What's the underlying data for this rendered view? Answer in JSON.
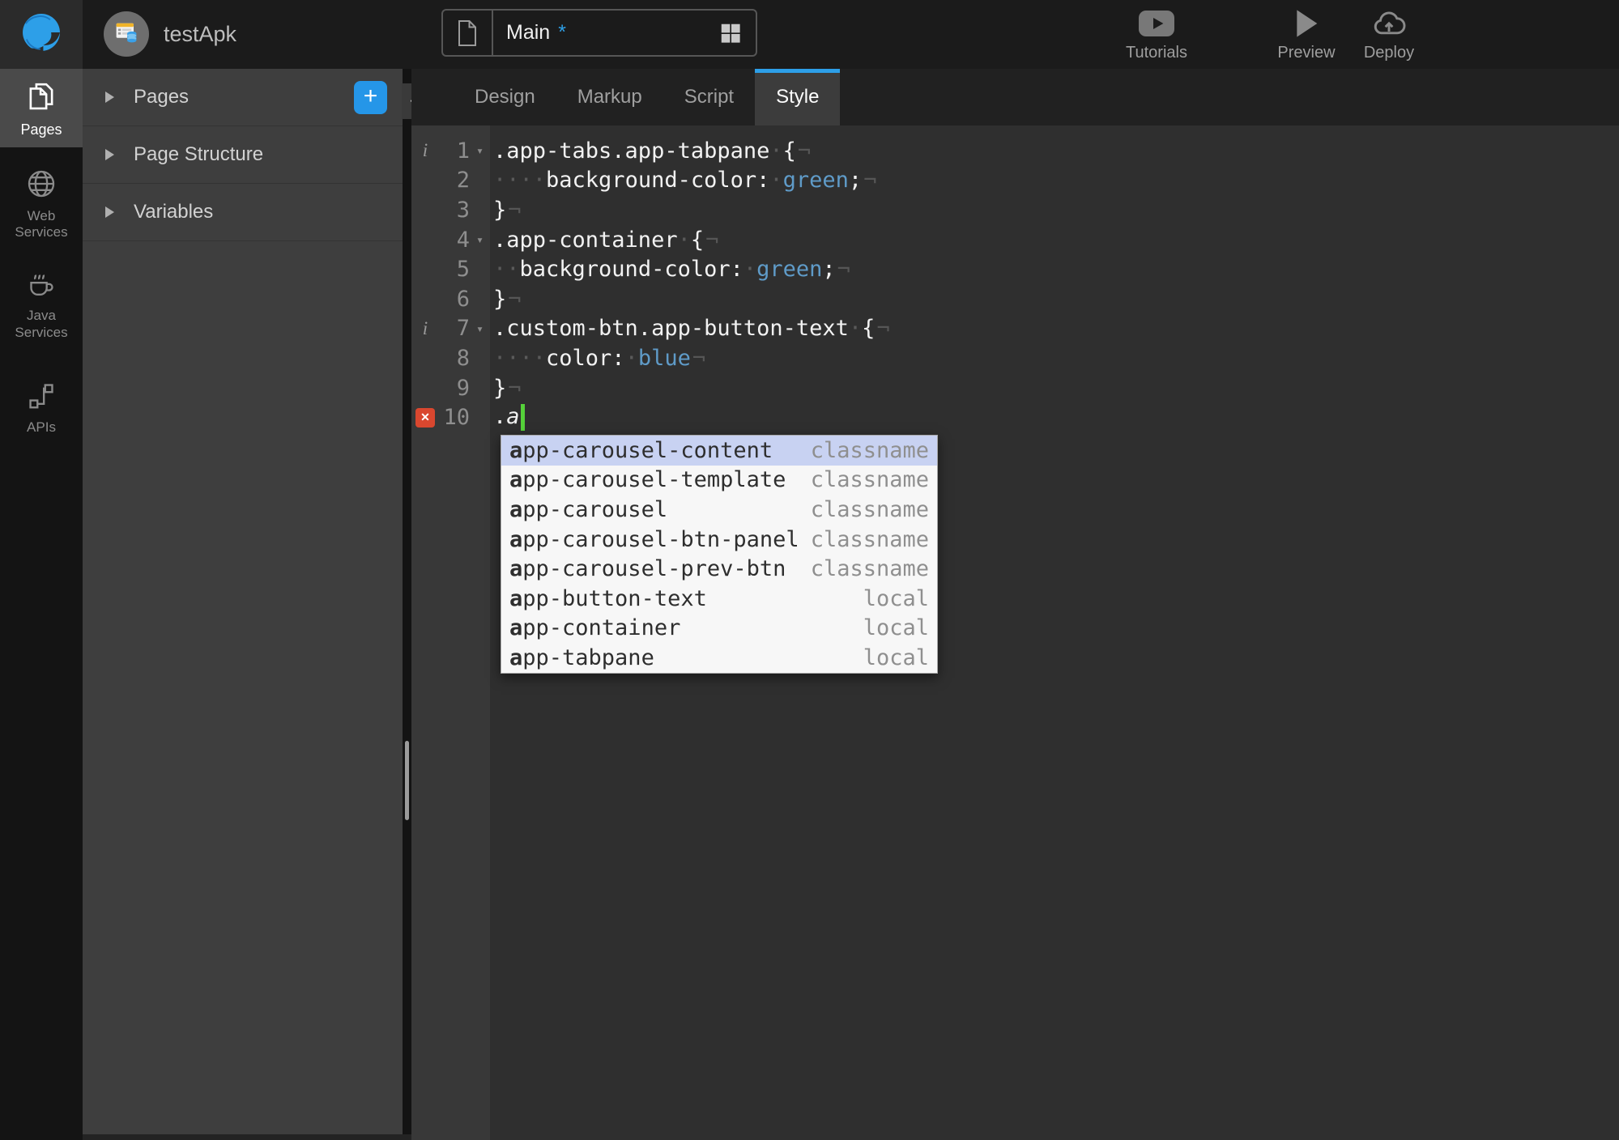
{
  "topbar": {
    "app_name": "testApk",
    "page_tab": {
      "label": "Main",
      "dirty_marker": "*"
    },
    "actions": {
      "tutorials": "Tutorials",
      "preview": "Preview",
      "deploy": "Deploy"
    }
  },
  "rail": {
    "items": [
      {
        "label": "Pages",
        "active": true
      },
      {
        "label": "Web Services",
        "active": false
      },
      {
        "label": "Java Services",
        "active": false
      },
      {
        "label": "APIs",
        "active": false
      }
    ]
  },
  "panel": {
    "sections": [
      {
        "label": "Pages"
      },
      {
        "label": "Page Structure"
      },
      {
        "label": "Variables"
      }
    ],
    "add_label": "+",
    "collapse_glyph": "«"
  },
  "editor": {
    "tabs": [
      {
        "label": "Design"
      },
      {
        "label": "Markup"
      },
      {
        "label": "Script"
      },
      {
        "label": "Style",
        "active": true
      }
    ],
    "lines": [
      {
        "num": "1",
        "info": true,
        "fold": true,
        "tokens": [
          [
            "t",
            ".app-tabs.app-tabpane"
          ],
          [
            "ws",
            "·"
          ],
          [
            "t",
            "{"
          ],
          [
            "eol",
            "¬"
          ]
        ]
      },
      {
        "num": "2",
        "tokens": [
          [
            "ws",
            "····"
          ],
          [
            "t",
            "background-color:"
          ],
          [
            "ws",
            "·"
          ],
          [
            "val",
            "green"
          ],
          [
            "t",
            ";"
          ],
          [
            "eol",
            "¬"
          ]
        ]
      },
      {
        "num": "3",
        "tokens": [
          [
            "t",
            "}"
          ],
          [
            "eol",
            "¬"
          ]
        ]
      },
      {
        "num": "4",
        "fold": true,
        "tokens": [
          [
            "t",
            ".app-container"
          ],
          [
            "ws",
            "·"
          ],
          [
            "t",
            "{"
          ],
          [
            "eol",
            "¬"
          ]
        ]
      },
      {
        "num": "5",
        "tokens": [
          [
            "ws",
            "··"
          ],
          [
            "t",
            "background-color:"
          ],
          [
            "ws",
            "·"
          ],
          [
            "val",
            "green"
          ],
          [
            "t",
            ";"
          ],
          [
            "eol",
            "¬"
          ]
        ]
      },
      {
        "num": "6",
        "tokens": [
          [
            "t",
            "}"
          ],
          [
            "eol",
            "¬"
          ]
        ]
      },
      {
        "num": "7",
        "info": true,
        "fold": true,
        "tokens": [
          [
            "t",
            ".custom-btn.app-button-text"
          ],
          [
            "ws",
            "·"
          ],
          [
            "t",
            "{"
          ],
          [
            "eol",
            "¬"
          ]
        ]
      },
      {
        "num": "8",
        "tokens": [
          [
            "ws",
            "····"
          ],
          [
            "t",
            "color:"
          ],
          [
            "ws",
            "·"
          ],
          [
            "val",
            "blue"
          ],
          [
            "eol",
            "¬"
          ]
        ]
      },
      {
        "num": "9",
        "tokens": [
          [
            "t",
            "}"
          ],
          [
            "eol",
            "¬"
          ]
        ]
      },
      {
        "num": "10",
        "error": true,
        "tokens": [
          [
            "t",
            "."
          ],
          [
            "it",
            "a"
          ],
          [
            "cursor",
            ""
          ]
        ]
      }
    ],
    "autocomplete": {
      "items": [
        {
          "name": "app-carousel-content",
          "kind": "classname",
          "selected": true
        },
        {
          "name": "app-carousel-template",
          "kind": "classname"
        },
        {
          "name": "app-carousel",
          "kind": "classname"
        },
        {
          "name": "app-carousel-btn-panel",
          "kind": "classname"
        },
        {
          "name": "app-carousel-prev-btn",
          "kind": "classname"
        },
        {
          "name": "app-button-text",
          "kind": "local"
        },
        {
          "name": "app-container",
          "kind": "local"
        },
        {
          "name": "app-tabpane",
          "kind": "local"
        }
      ]
    }
  },
  "colors": {
    "accent_blue": "#2d9fe8",
    "code_value_blue": "#5f9bc8",
    "cursor_green": "#55d13a",
    "error_red": "#d9472f",
    "dropdown_selection": "#c8d2f2",
    "dropdown_bg": "#f7f7f7",
    "editor_bg": "#2f2f2f",
    "gutter_bg": "#383838",
    "panel_bg": "#3e3e3e",
    "rail_bg": "#141414",
    "topbar_bg": "#1b1b1b"
  }
}
